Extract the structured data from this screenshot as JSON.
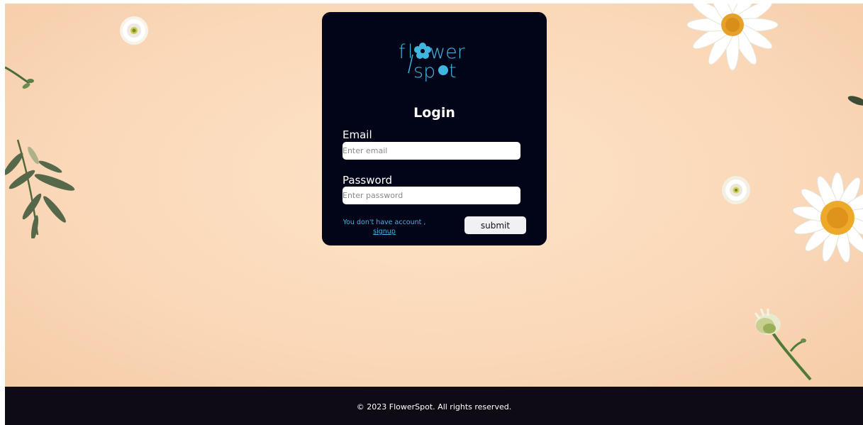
{
  "brand": {
    "logo_line1": "flower",
    "logo_line2": "spot"
  },
  "login": {
    "title": "Login",
    "email_label": "Email",
    "email_placeholder": "Enter email",
    "password_label": "Password",
    "password_placeholder": "Enter password",
    "signup_prompt": "You don't have account ,",
    "signup_link": "signup",
    "submit_label": "submit"
  },
  "footer": {
    "copyright": "© 2023 FlowerSpot. All rights reserved."
  },
  "colors": {
    "card_bg": "#020417",
    "accent": "#3fb6e0",
    "background": "#fad8b8",
    "footer_bg": "#0e0b14"
  },
  "icons": {
    "logo_flower": "flower-logo-icon"
  }
}
